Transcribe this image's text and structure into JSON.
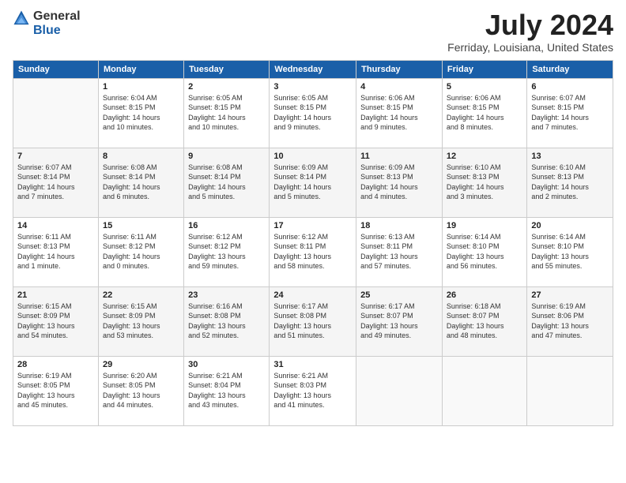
{
  "logo": {
    "general": "General",
    "blue": "Blue"
  },
  "header": {
    "month": "July 2024",
    "location": "Ferriday, Louisiana, United States"
  },
  "weekdays": [
    "Sunday",
    "Monday",
    "Tuesday",
    "Wednesday",
    "Thursday",
    "Friday",
    "Saturday"
  ],
  "weeks": [
    [
      {
        "day": "",
        "info": ""
      },
      {
        "day": "1",
        "info": "Sunrise: 6:04 AM\nSunset: 8:15 PM\nDaylight: 14 hours\nand 10 minutes."
      },
      {
        "day": "2",
        "info": "Sunrise: 6:05 AM\nSunset: 8:15 PM\nDaylight: 14 hours\nand 10 minutes."
      },
      {
        "day": "3",
        "info": "Sunrise: 6:05 AM\nSunset: 8:15 PM\nDaylight: 14 hours\nand 9 minutes."
      },
      {
        "day": "4",
        "info": "Sunrise: 6:06 AM\nSunset: 8:15 PM\nDaylight: 14 hours\nand 9 minutes."
      },
      {
        "day": "5",
        "info": "Sunrise: 6:06 AM\nSunset: 8:15 PM\nDaylight: 14 hours\nand 8 minutes."
      },
      {
        "day": "6",
        "info": "Sunrise: 6:07 AM\nSunset: 8:15 PM\nDaylight: 14 hours\nand 7 minutes."
      }
    ],
    [
      {
        "day": "7",
        "info": "Sunrise: 6:07 AM\nSunset: 8:14 PM\nDaylight: 14 hours\nand 7 minutes."
      },
      {
        "day": "8",
        "info": "Sunrise: 6:08 AM\nSunset: 8:14 PM\nDaylight: 14 hours\nand 6 minutes."
      },
      {
        "day": "9",
        "info": "Sunrise: 6:08 AM\nSunset: 8:14 PM\nDaylight: 14 hours\nand 5 minutes."
      },
      {
        "day": "10",
        "info": "Sunrise: 6:09 AM\nSunset: 8:14 PM\nDaylight: 14 hours\nand 5 minutes."
      },
      {
        "day": "11",
        "info": "Sunrise: 6:09 AM\nSunset: 8:13 PM\nDaylight: 14 hours\nand 4 minutes."
      },
      {
        "day": "12",
        "info": "Sunrise: 6:10 AM\nSunset: 8:13 PM\nDaylight: 14 hours\nand 3 minutes."
      },
      {
        "day": "13",
        "info": "Sunrise: 6:10 AM\nSunset: 8:13 PM\nDaylight: 14 hours\nand 2 minutes."
      }
    ],
    [
      {
        "day": "14",
        "info": "Sunrise: 6:11 AM\nSunset: 8:13 PM\nDaylight: 14 hours\nand 1 minute."
      },
      {
        "day": "15",
        "info": "Sunrise: 6:11 AM\nSunset: 8:12 PM\nDaylight: 14 hours\nand 0 minutes."
      },
      {
        "day": "16",
        "info": "Sunrise: 6:12 AM\nSunset: 8:12 PM\nDaylight: 13 hours\nand 59 minutes."
      },
      {
        "day": "17",
        "info": "Sunrise: 6:12 AM\nSunset: 8:11 PM\nDaylight: 13 hours\nand 58 minutes."
      },
      {
        "day": "18",
        "info": "Sunrise: 6:13 AM\nSunset: 8:11 PM\nDaylight: 13 hours\nand 57 minutes."
      },
      {
        "day": "19",
        "info": "Sunrise: 6:14 AM\nSunset: 8:10 PM\nDaylight: 13 hours\nand 56 minutes."
      },
      {
        "day": "20",
        "info": "Sunrise: 6:14 AM\nSunset: 8:10 PM\nDaylight: 13 hours\nand 55 minutes."
      }
    ],
    [
      {
        "day": "21",
        "info": "Sunrise: 6:15 AM\nSunset: 8:09 PM\nDaylight: 13 hours\nand 54 minutes."
      },
      {
        "day": "22",
        "info": "Sunrise: 6:15 AM\nSunset: 8:09 PM\nDaylight: 13 hours\nand 53 minutes."
      },
      {
        "day": "23",
        "info": "Sunrise: 6:16 AM\nSunset: 8:08 PM\nDaylight: 13 hours\nand 52 minutes."
      },
      {
        "day": "24",
        "info": "Sunrise: 6:17 AM\nSunset: 8:08 PM\nDaylight: 13 hours\nand 51 minutes."
      },
      {
        "day": "25",
        "info": "Sunrise: 6:17 AM\nSunset: 8:07 PM\nDaylight: 13 hours\nand 49 minutes."
      },
      {
        "day": "26",
        "info": "Sunrise: 6:18 AM\nSunset: 8:07 PM\nDaylight: 13 hours\nand 48 minutes."
      },
      {
        "day": "27",
        "info": "Sunrise: 6:19 AM\nSunset: 8:06 PM\nDaylight: 13 hours\nand 47 minutes."
      }
    ],
    [
      {
        "day": "28",
        "info": "Sunrise: 6:19 AM\nSunset: 8:05 PM\nDaylight: 13 hours\nand 45 minutes."
      },
      {
        "day": "29",
        "info": "Sunrise: 6:20 AM\nSunset: 8:05 PM\nDaylight: 13 hours\nand 44 minutes."
      },
      {
        "day": "30",
        "info": "Sunrise: 6:21 AM\nSunset: 8:04 PM\nDaylight: 13 hours\nand 43 minutes."
      },
      {
        "day": "31",
        "info": "Sunrise: 6:21 AM\nSunset: 8:03 PM\nDaylight: 13 hours\nand 41 minutes."
      },
      {
        "day": "",
        "info": ""
      },
      {
        "day": "",
        "info": ""
      },
      {
        "day": "",
        "info": ""
      }
    ]
  ]
}
